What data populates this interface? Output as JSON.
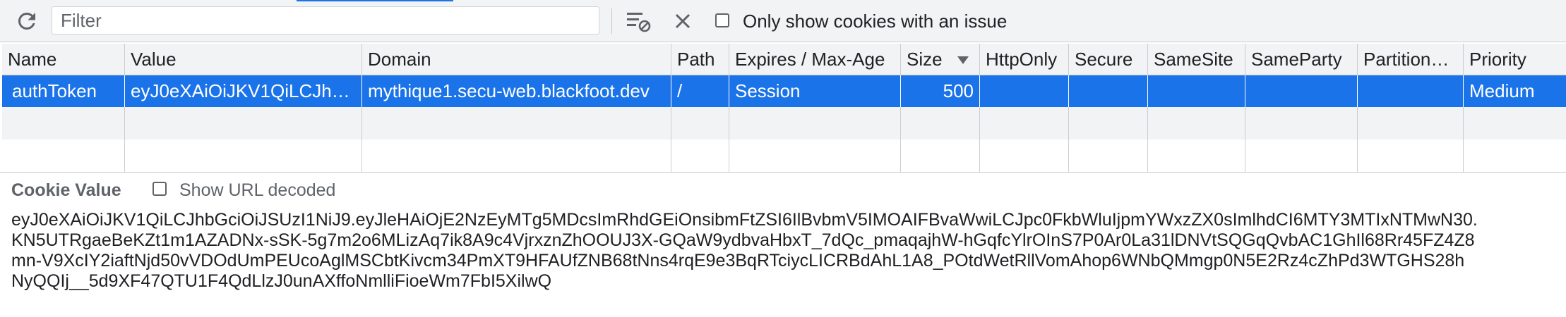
{
  "toolbar": {
    "filter_placeholder": "Filter",
    "only_issue_label": "Only show cookies with an issue",
    "only_issue_checked": false
  },
  "table": {
    "columns": [
      "Name",
      "Value",
      "Domain",
      "Path",
      "Expires / Max-Age",
      "Size",
      "HttpOnly",
      "Secure",
      "SameSite",
      "SameParty",
      "Partition…",
      "Priority"
    ],
    "sorted_column": "Size",
    "sort_direction": "descending",
    "rows": [
      {
        "name": "authToken",
        "value": "eyJ0eXAiOiJKV1QiLCJh…",
        "domain": "mythique1.secu-web.blackfoot.dev",
        "path": "/",
        "expires": "Session",
        "size": "500",
        "httponly": "",
        "secure": "",
        "samesite": "",
        "sameparty": "",
        "partition": "",
        "priority": "Medium",
        "selected": true
      }
    ]
  },
  "cookie_value": {
    "title": "Cookie Value",
    "url_decoded_label": "Show URL decoded",
    "url_decoded_checked": false,
    "lines": [
      "eyJ0eXAiOiJKV1QiLCJhbGciOiJSUzI1NiJ9.eyJleHAiOjE2NzEyMTg5MDcsImRhdGEiOnsibmFtZSI6IlBvbmV5IMOAIFBvaWwiLCJpc0FkbWluIjpmYWxzZX0sImlhdCI6MTY3MTIxNTMwN30.",
      "KN5UTRgaeBeKZt1m1AZADNx-sSK-5g7m2o6MLizAq7ik8A9c4VjrxznZhOOUJ3X-GQaW9ydbvaHbxT_7dQc_pmaqajhW-hGqfcYlrOInS7P0Ar0La31lDNVtSQGqQvbAC1GhIl68Rr45FZ4Z8",
      "mn-V9XcIY2iaftNjd50vVDOdUmPEUcoAglMSCbtKivcm34PmXT9HFAUfZNB68tNns4rqE9e3BqRTciycLICRBdAhL1A8_POtdWetRllVomAhop6WNbQMmgp0N5E2Rz4cZhPd3WTGHS28h",
      "NyQQIj__5d9XF47QTU1F4QdLlzJ0unAXffoNmlliFioeWm7FbI5XilwQ"
    ]
  },
  "colors": {
    "selection": "#1a73e8",
    "toolbar_bg": "#f1f3f4",
    "text": "#202124",
    "muted": "#5f6368"
  }
}
